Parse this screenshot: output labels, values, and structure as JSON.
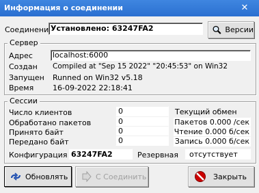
{
  "window": {
    "title": "Информация о соединении",
    "close": "✕"
  },
  "connection": {
    "label": "Соединение",
    "status": "Установлено: 63247FA2",
    "versions_button": "Версии"
  },
  "server": {
    "legend": "Сервер",
    "fields": [
      {
        "label": "Адрес",
        "value": "localhost:6000"
      },
      {
        "label": "Создан",
        "value": "Compiled at \"Sep 15 2022\" \"20:45:53\" on Win32"
      },
      {
        "label": "Запущен",
        "value": "Runned on Win32 v5.18"
      },
      {
        "label": "Время",
        "value": "16-09-2022 22:18:41"
      }
    ]
  },
  "sessions": {
    "legend": "Сессии",
    "counters": [
      {
        "label": "Число клиентов",
        "value": "0"
      },
      {
        "label": "Обработано пакетов",
        "value": "0"
      },
      {
        "label": "Принято байт",
        "value": "0"
      },
      {
        "label": "Передано байт",
        "value": "0"
      }
    ],
    "exchange_title": "Текущий обмен",
    "exchange": [
      {
        "label": "Пакетов",
        "value": "0.000 /сек"
      },
      {
        "label": "Чтение",
        "value": "0.000 б/сек"
      },
      {
        "label": "Запись",
        "value": "0.000 б/сек"
      }
    ],
    "config_label": "Конфигурация",
    "config_value": "63247FA2",
    "backup_label": "Резервная",
    "backup_value": "отсутствует"
  },
  "buttons": {
    "refresh": "Обновлять",
    "connect": "С Соединить",
    "close": "Закрыть"
  },
  "colors": {
    "title_bar": "#2a6fd0",
    "close_icon": "#cc0000"
  }
}
